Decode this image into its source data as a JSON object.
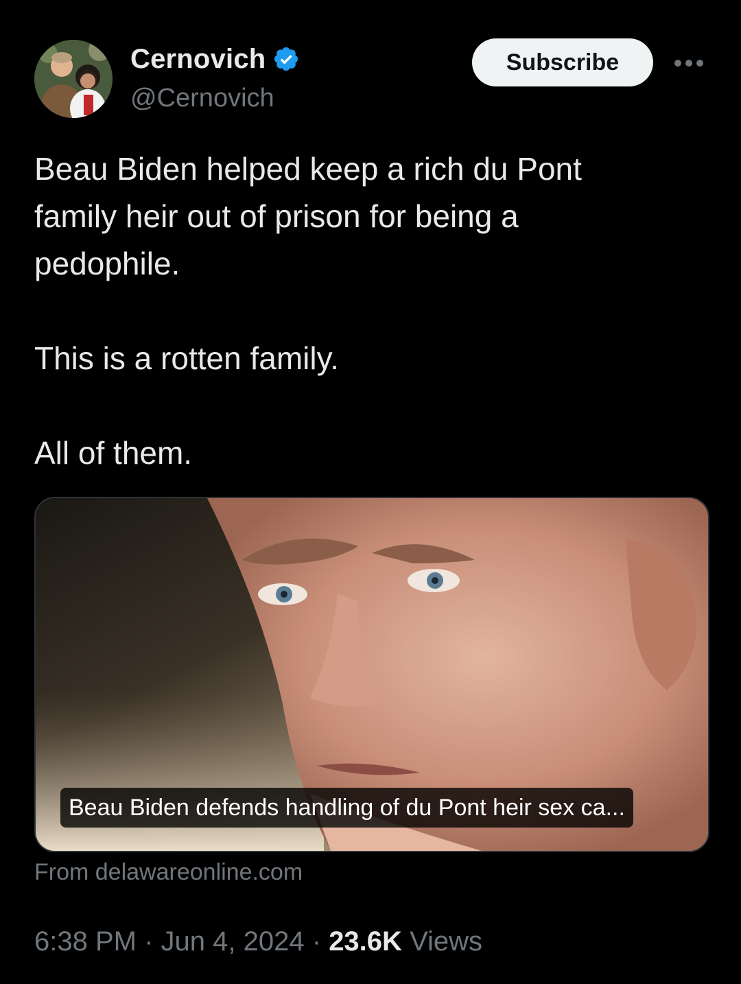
{
  "author": {
    "display_name": "Cernovich",
    "handle": "@Cernovich",
    "verified_icon": "verified-badge-icon",
    "verified_color": "#1d9bf0"
  },
  "header": {
    "subscribe_label": "Subscribe",
    "more_icon": "more-options-icon"
  },
  "tweet": {
    "lines": [
      "Beau Biden helped keep a rich du Pont",
      "family heir out of prison for being a",
      "pedophile."
    ],
    "paragraph2": "This is a rotten family.",
    "paragraph3": "All of them."
  },
  "link_card": {
    "caption": "Beau Biden defends handling of du Pont heir sex ca...",
    "source": "From delawareonline.com"
  },
  "meta": {
    "time": "6:38 PM",
    "separator": "·",
    "date": "Jun 4, 2024",
    "views_count": "23.6K",
    "views_label": "Views"
  },
  "colors": {
    "background": "#000000",
    "text_primary": "#e7e9ea",
    "text_secondary": "#71767b",
    "button_bg": "#eff3f4"
  }
}
